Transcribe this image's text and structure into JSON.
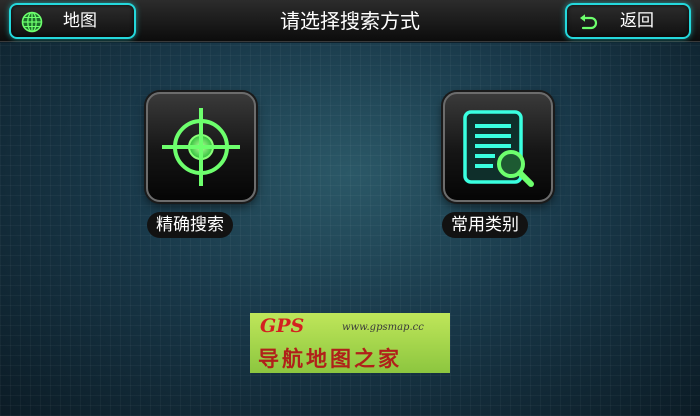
{
  "header": {
    "title": "请选择搜索方式",
    "map_button": {
      "label": "地图",
      "icon": "globe-icon"
    },
    "back_button": {
      "label": "返回",
      "icon": "return-arrow-icon"
    }
  },
  "options": [
    {
      "label": "精确搜索",
      "icon": "crosshair-icon"
    },
    {
      "label": "常用类别",
      "icon": "list-search-icon"
    }
  ],
  "watermark": {
    "brand": "GPS",
    "url": "www.gpsmap.cc",
    "text": "导航地图之家"
  },
  "colors": {
    "accent_cyan": "#24d8dc",
    "icon_green": "#6dff6d",
    "icon_aqua": "#3affe0",
    "watermark_green": "#8cc63f",
    "watermark_red": "#d42020"
  }
}
